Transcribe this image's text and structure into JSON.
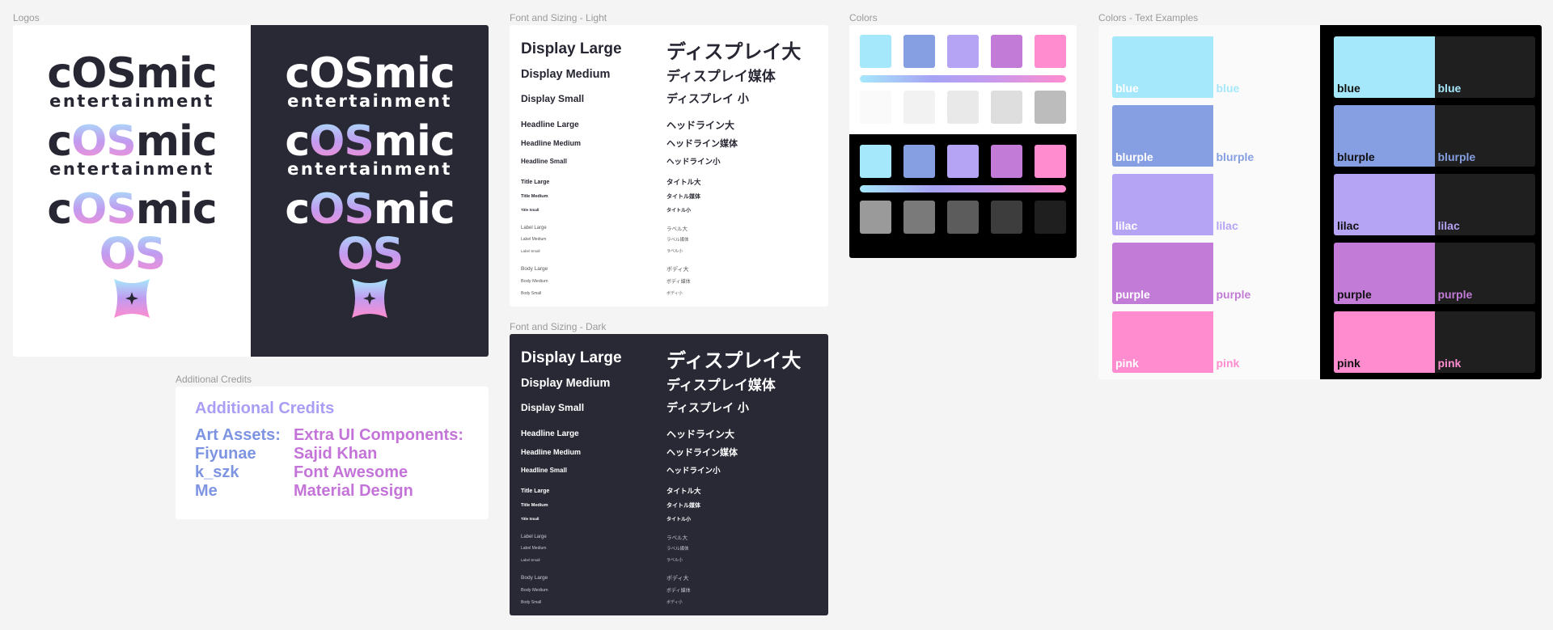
{
  "frames": {
    "logos": "Logos",
    "additional_credits": "Additional Credits",
    "font_light": "Font and Sizing - Light",
    "font_dark": "Font and Sizing - Dark",
    "colors": "Colors",
    "colors_text": "Colors - Text Examples"
  },
  "logo": {
    "word_c": "c",
    "word_os": "OS",
    "word_mic": "mic",
    "subline": "entertainment",
    "os_mark": "OS"
  },
  "credits": {
    "title": "Additional Credits",
    "art_assets_heading": "Art Assets:",
    "art_assets": [
      "Fiyunae",
      "k_szk",
      "Me"
    ],
    "ui_heading": "Extra UI Components:",
    "ui_components": [
      "Sajid Khan",
      "Font Awesome",
      "Material Design"
    ]
  },
  "type_scale": [
    {
      "en": "Display Large",
      "jp": "ディスプレイ大"
    },
    {
      "en": "Display Medium",
      "jp": "ディスプレイ媒体"
    },
    {
      "en": "Display Small",
      "jp": "ディスプレイ 小"
    },
    {
      "en": "Headline Large",
      "jp": "ヘッドライン大"
    },
    {
      "en": "Headline Medium",
      "jp": "ヘッドライン媒体"
    },
    {
      "en": "Headline Small",
      "jp": "ヘッドライン小"
    },
    {
      "en": "Title Large",
      "jp": "タイトル大"
    },
    {
      "en": "Title Medium",
      "jp": "タイトル媒体"
    },
    {
      "en": "Title Small",
      "jp": "タイトル小"
    },
    {
      "en": "Label Large",
      "jp": "ラベル大"
    },
    {
      "en": "Label Medium",
      "jp": "ラベル媒体"
    },
    {
      "en": "Label Small",
      "jp": "ラベル小"
    },
    {
      "en": "Body Large",
      "jp": "ボディ大"
    },
    {
      "en": "Body Medium",
      "jp": "ボディ媒体"
    },
    {
      "en": "Body Small",
      "jp": "ボディ小"
    }
  ],
  "palette": {
    "blue": "#a6e8fb",
    "blurple": "#869ee2",
    "lilac": "#b5a3f3",
    "purple": "#c37bd8",
    "pink": "#ff8ccf",
    "neutrals_light": [
      "#fafafa",
      "#f2f2f2",
      "#e9e9e9",
      "#dedede",
      "#bcbcbc"
    ],
    "neutrals_dark": [
      "#9a9a9a",
      "#7a7a7a",
      "#5c5c5c",
      "#3d3d3d",
      "#1f1f1f"
    ],
    "light_bg": "#fafafa",
    "dark_bg": "#1f1f1f",
    "brand_dark": "#292936"
  },
  "color_names": [
    "blue",
    "blurple",
    "lilac",
    "purple",
    "pink"
  ]
}
